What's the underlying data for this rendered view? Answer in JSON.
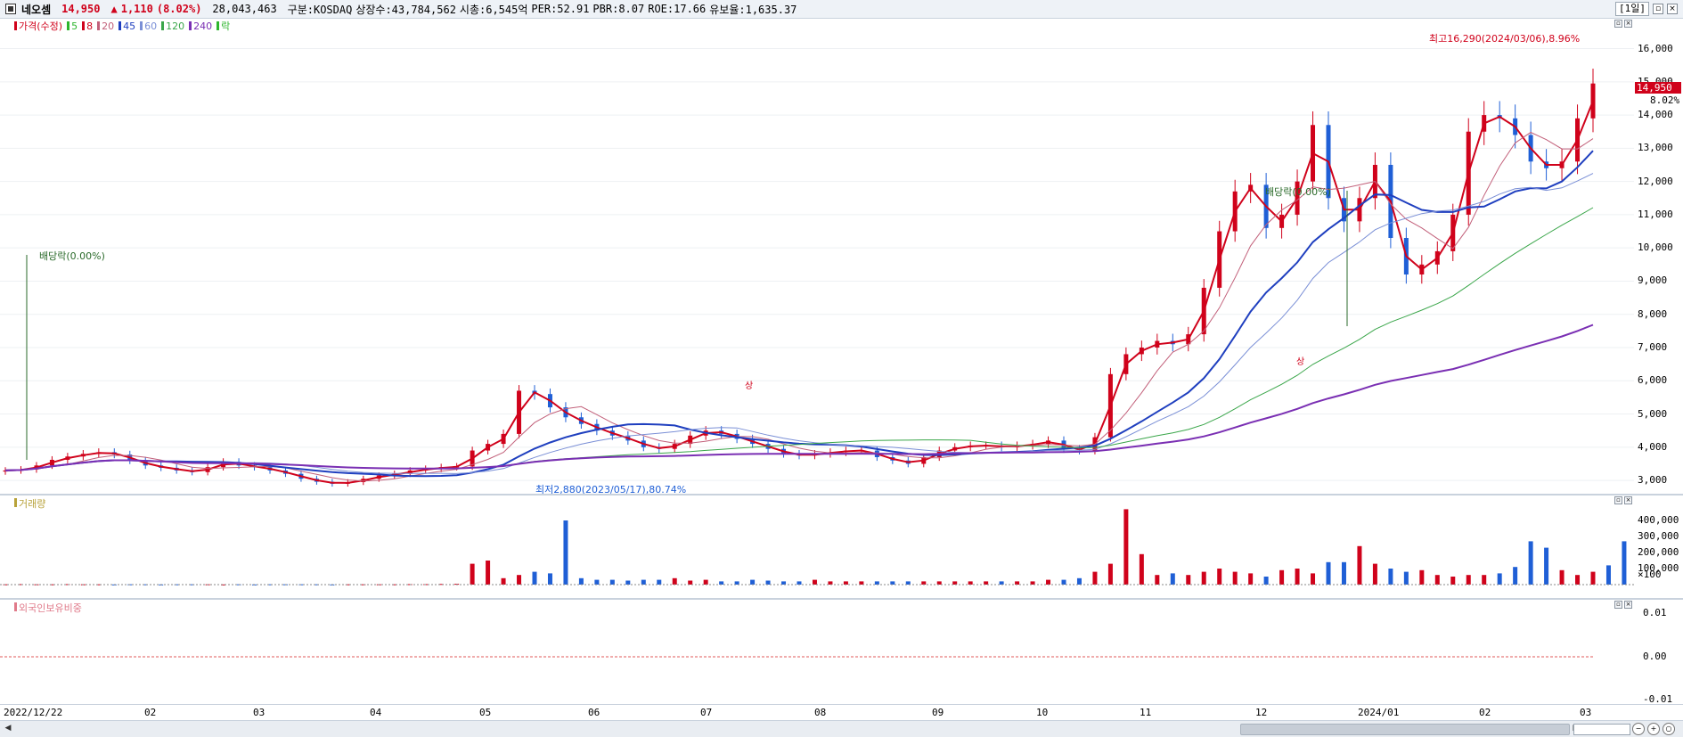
{
  "header": {
    "name": "네오셈",
    "price": "14,950",
    "change_arrow": "▲",
    "change": "1,110",
    "change_pct": "(8.02%)",
    "volume": "28,043,463",
    "market": "구분:KOSDAQ",
    "shares": "상장수:43,784,562",
    "mcap": "시총:6,545억",
    "per": "PER:52.91",
    "pbr": "PBR:8.07",
    "roe": "ROE:17.66",
    "reserve": "유보율:1,635.37",
    "period": "[1일]"
  },
  "legend": {
    "price_label": "가격(수정)",
    "ma5": "5",
    "ma8": "8",
    "ma20": "20",
    "ma45": "45",
    "ma60": "60",
    "ma120": "120",
    "ma240": "240",
    "event": "락"
  },
  "annotations": {
    "high": "최고16,290(2024/03/06),8.96%",
    "low": "최저2,880(2023/05/17),80.74%",
    "div1": "배당락(0.00%)",
    "div2": "배당락(0.00%)",
    "sang1": "상",
    "sang2": "상"
  },
  "price_badge": {
    "price": "14,950",
    "pct": "8.02%"
  },
  "volume_panel": {
    "title": "거래량"
  },
  "foreign_panel": {
    "title": "외국인보유비중"
  },
  "price_axis": [
    "16,000",
    "15,000",
    "14,000",
    "13,000",
    "12,000",
    "11,000",
    "10,000",
    "9,000",
    "8,000",
    "7,000",
    "6,000",
    "5,000",
    "4,000",
    "3,000"
  ],
  "volume_axis": [
    "400,000",
    "300,000",
    "200,000",
    "100,000",
    "×100"
  ],
  "foreign_axis": [
    "0.01",
    "0.00",
    "-0.01"
  ],
  "x_axis": [
    "2022/12/22",
    "02",
    "03",
    "04",
    "05",
    "06",
    "07",
    "08",
    "09",
    "10",
    "11",
    "12",
    "2024/01",
    "02",
    "03"
  ],
  "colors": {
    "up": "#d0021b",
    "down": "#1f5fd6",
    "ma5": "#2db52d",
    "ma8": "#d0021b",
    "ma20": "#c2607a",
    "ma45": "#1f3fbf",
    "ma60": "#7a8fd6",
    "ma120": "#3aa64a",
    "ma240": "#7a2fb3"
  },
  "chart_data": {
    "type": "candlestick",
    "price_range": [
      2600,
      16900
    ],
    "series_close": [
      3300,
      3330,
      3450,
      3620,
      3720,
      3800,
      3850,
      3780,
      3600,
      3450,
      3380,
      3300,
      3250,
      3400,
      3560,
      3450,
      3400,
      3300,
      3200,
      3050,
      2960,
      2900,
      2950,
      3050,
      3150,
      3200,
      3300,
      3350,
      3400,
      3420,
      3900,
      4100,
      4400,
      5700,
      5600,
      5200,
      4900,
      4700,
      4500,
      4350,
      4200,
      4000,
      3950,
      4100,
      4350,
      4500,
      4400,
      4250,
      4100,
      3950,
      3800,
      3750,
      3800,
      3850,
      3900,
      3900,
      3700,
      3600,
      3500,
      3700,
      3900,
      4000,
      4050,
      4050,
      4000,
      4050,
      4100,
      4200,
      3950,
      3900,
      4300,
      6200,
      6800,
      7000,
      7200,
      7100,
      7400,
      8800,
      10500,
      11700,
      11900,
      10600,
      11000,
      12000,
      13700,
      11500,
      10800,
      11500,
      12500,
      10300,
      9200,
      9500,
      9900,
      11000,
      13500,
      14000,
      13900,
      13400,
      12600,
      12400,
      12600,
      13900,
      14950
    ],
    "volume_x100": [
      2,
      3,
      2,
      2,
      3,
      2,
      2,
      1,
      2,
      2,
      1,
      2,
      2,
      2,
      1,
      2,
      1,
      2,
      2,
      2,
      2,
      1,
      2,
      2,
      2,
      2,
      3,
      3,
      4,
      5,
      130,
      150,
      40,
      60,
      80,
      70,
      400,
      40,
      30,
      30,
      25,
      30,
      30,
      40,
      25,
      30,
      20,
      20,
      30,
      25,
      20,
      20,
      30,
      20,
      20,
      20,
      20,
      20,
      20,
      20,
      20,
      20,
      20,
      20,
      20,
      20,
      20,
      30,
      30,
      40,
      80,
      130,
      470,
      190,
      60,
      70,
      60,
      80,
      100,
      80,
      70,
      50,
      90,
      100,
      70,
      140,
      140,
      240,
      130,
      100,
      80,
      90,
      60,
      50,
      60,
      60,
      70,
      110,
      270,
      230,
      90,
      60,
      80,
      120,
      270
    ],
    "ma_lines": [
      "5",
      "8",
      "20",
      "45",
      "60",
      "120",
      "240"
    ]
  }
}
